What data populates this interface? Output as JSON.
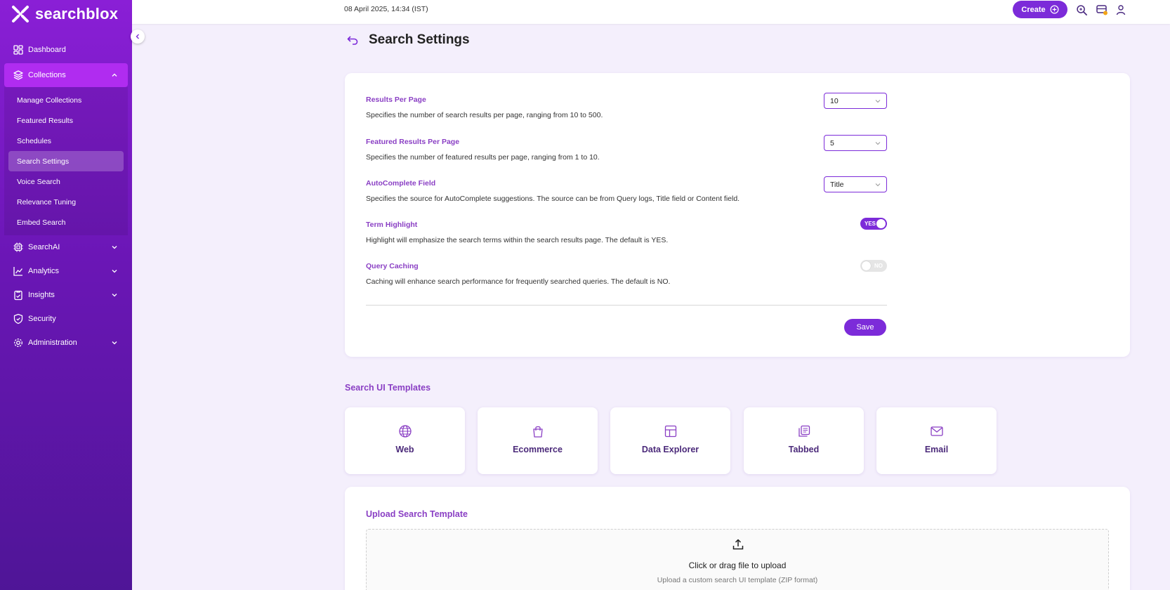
{
  "brand": {
    "logo_text": "searchblox"
  },
  "topbar": {
    "datetime": "08 April 2025, 14:34 (IST)",
    "create_label": "Create"
  },
  "sidebar": {
    "items": [
      {
        "label": "Dashboard"
      },
      {
        "label": "Collections"
      },
      {
        "label": "SearchAI"
      },
      {
        "label": "Analytics"
      },
      {
        "label": "Insights"
      },
      {
        "label": "Security"
      },
      {
        "label": "Administration"
      }
    ],
    "collections_sub": [
      {
        "label": "Manage Collections"
      },
      {
        "label": "Featured Results"
      },
      {
        "label": "Schedules"
      },
      {
        "label": "Search Settings"
      },
      {
        "label": "Voice Search"
      },
      {
        "label": "Relevance Tuning"
      },
      {
        "label": "Embed Search"
      }
    ]
  },
  "page": {
    "title": "Search Settings"
  },
  "settings": {
    "results_per_page": {
      "label": "Results Per Page",
      "desc": "Specifies the number of search results per page, ranging from 10 to 500.",
      "value": "10"
    },
    "featured_per_page": {
      "label": "Featured Results Per Page",
      "desc": "Specifies the number of featured results per page, ranging from 1 to 10.",
      "value": "5"
    },
    "autocomplete": {
      "label": "AutoComplete Field",
      "desc": "Specifies the source for AutoComplete suggestions. The source can be from Query logs, Title field or Content field.",
      "value": "Title"
    },
    "term_highlight": {
      "label": "Term Highlight",
      "desc": "Highlight will emphasize the search terms within the search results page. The default is YES.",
      "state": "YES"
    },
    "query_caching": {
      "label": "Query Caching",
      "desc": "Caching will enhance search performance for frequently searched queries. The default is NO.",
      "state": "NO"
    },
    "save_label": "Save"
  },
  "templates": {
    "title": "Search UI Templates",
    "items": [
      {
        "label": "Web",
        "icon": "globe-icon"
      },
      {
        "label": "Ecommerce",
        "icon": "shopping-bag-icon"
      },
      {
        "label": "Data Explorer",
        "icon": "grid-icon"
      },
      {
        "label": "Tabbed",
        "icon": "tabs-icon"
      },
      {
        "label": "Email",
        "icon": "mail-icon"
      }
    ]
  },
  "upload": {
    "title": "Upload Search Template",
    "main_text": "Click or drag file to upload",
    "sub_text": "Upload a custom search UI template (ZIP format)"
  },
  "colors": {
    "accent": "#7c2bd9",
    "label_purple": "#8a3fc4",
    "sidebar_active": "#b02cf0"
  }
}
